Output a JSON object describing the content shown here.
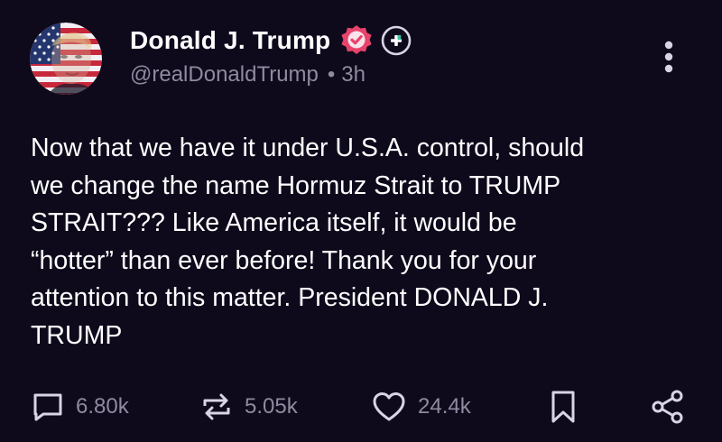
{
  "post": {
    "author": {
      "display_name": "Donald J. Trump",
      "handle": "@realDonaldTrump",
      "separator": "•",
      "timestamp": "3h",
      "verified_badge": "verified-check-icon",
      "extra_badge": "plus-badge-icon",
      "avatar": "profile-photo-flag-overlay"
    },
    "text": "Now that we have it under U.S.A. control, should\nwe change the name Hormuz Strait to TRUMP\nSTRAIT??? Like America itself, it would be\n“hotter” than ever before! Thank you for your\nattention to this matter. President DONALD J.\nTRUMP",
    "more_menu_icon": "vertical-ellipsis-icon",
    "actions": {
      "reply": {
        "icon": "comment-icon",
        "count": "6.80k"
      },
      "repost": {
        "icon": "repost-icon",
        "count": "5.05k"
      },
      "like": {
        "icon": "heart-icon",
        "count": "24.4k"
      },
      "bookmark": {
        "icon": "bookmark-icon"
      },
      "share": {
        "icon": "share-icon"
      }
    }
  },
  "colors": {
    "background": "#0e0a1c",
    "text_primary": "#ffffff",
    "text_secondary": "#8f8a9f",
    "verified_badge": "#e8436c",
    "icon": "#d8d4e4"
  }
}
